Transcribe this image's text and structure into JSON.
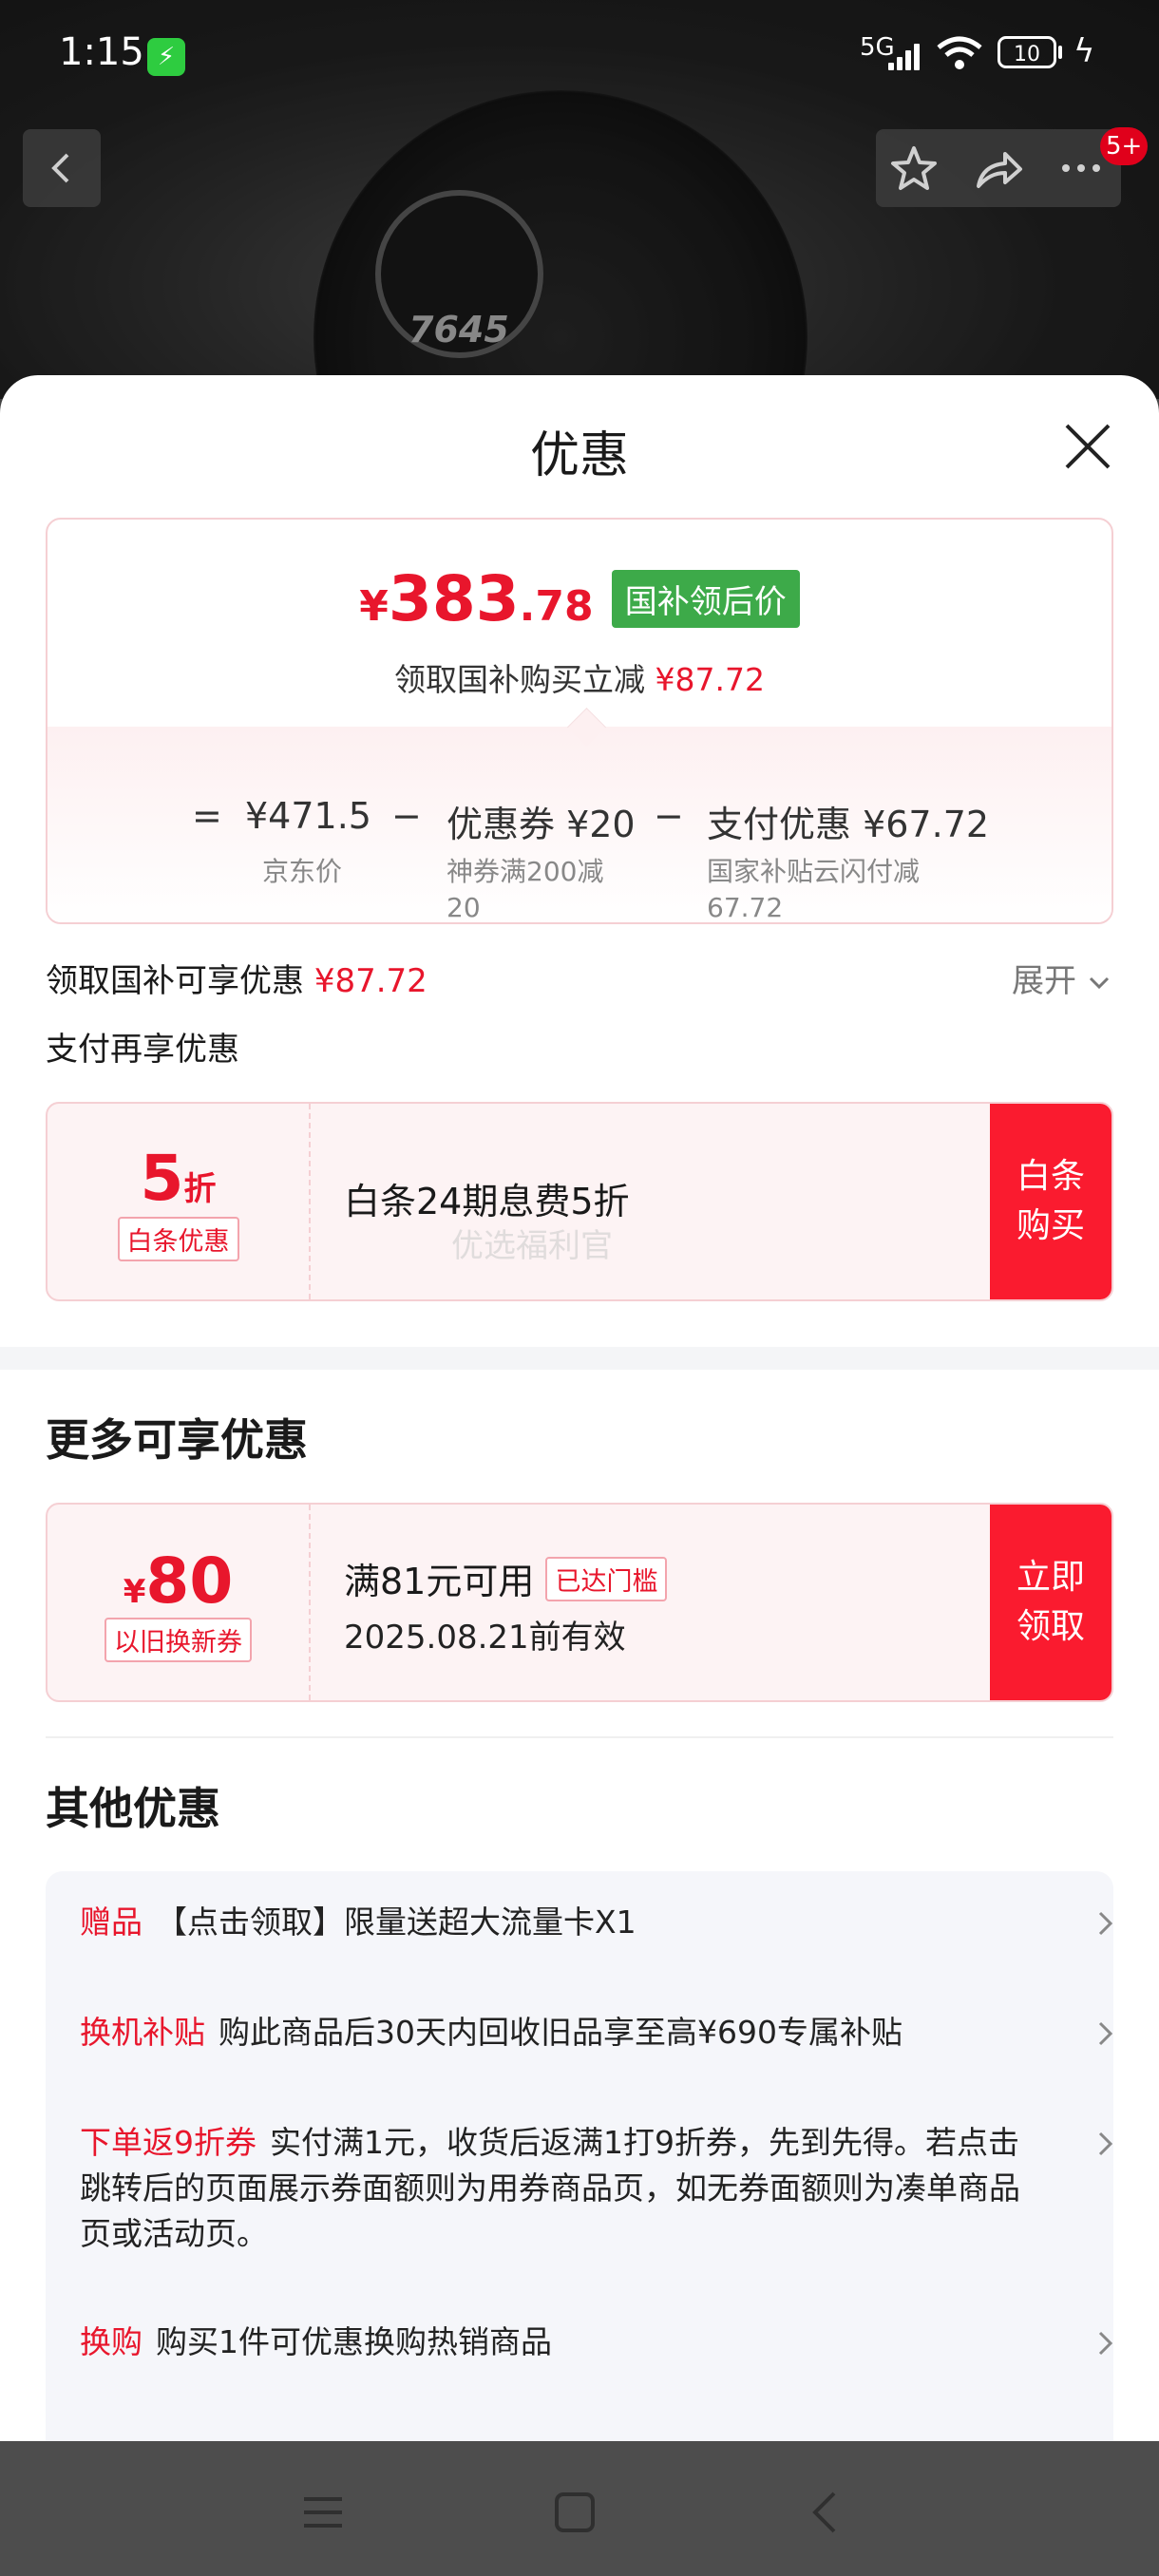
{
  "status_bar": {
    "time": "1:15",
    "network": "5G",
    "battery": "10"
  },
  "product_nav": {
    "cart_badge": "5+"
  },
  "product_image": {
    "steps": "7645"
  },
  "sheet": {
    "title": "优惠",
    "price": {
      "yen": "¥",
      "integer": "383",
      "decimal": ".78",
      "tag": "国补领后价",
      "subtitle_prefix": "领取国补购买立减",
      "subtitle_amount": "¥87.72",
      "formula": {
        "equals": "=",
        "base_value": "¥471.5",
        "base_label": "京东价",
        "minus1": "−",
        "coupon_value": "优惠券 ¥20",
        "coupon_label_line1": "神券满200减",
        "coupon_label_line2": "20",
        "minus2": "−",
        "pay_value": "支付优惠 ¥67.72",
        "pay_label_line1": "国家补贴云闪付减",
        "pay_label_line2": "67.72"
      }
    },
    "subsidy_row": {
      "label": "领取国补可享优惠",
      "amount": "¥87.72",
      "expand": "展开"
    },
    "pay_again": "支付再享优惠",
    "baitiao": {
      "big": "5",
      "unit": "折",
      "tag": "白条优惠",
      "desc": "白条24期息费5折",
      "watermark": "优选福利官",
      "button_line1": "白条",
      "button_line2": "购买"
    },
    "more_title": "更多可享优惠",
    "tradein_coupon": {
      "yen": "¥",
      "amount": "80",
      "tag": "以旧换新券",
      "condition": "满81元可用",
      "reached": "已达门槛",
      "expiry": "2025.08.21前有效",
      "button_line1": "立即",
      "button_line2": "领取"
    },
    "other_title": "其他优惠",
    "other_items": [
      {
        "tag": "赠品",
        "text": "【点击领取】限量送超大流量卡X1"
      },
      {
        "tag": "换机补贴",
        "text": "购此商品后30天内回收旧品享至高¥690专属补贴"
      },
      {
        "tag": "下单返9折券",
        "text": "实付满1元，收货后返满1打9折券，先到先得。若点击跳转后的页面展示券面额则为用券商品页，如无券面额则为凑单商品页或活动页。"
      },
      {
        "tag": "换购",
        "text": "购买1件可优惠换购热销商品"
      }
    ]
  },
  "colors": {
    "accent_red": "#e8162c",
    "button_red": "#fa1b2f",
    "green_tag": "#3daa49"
  }
}
